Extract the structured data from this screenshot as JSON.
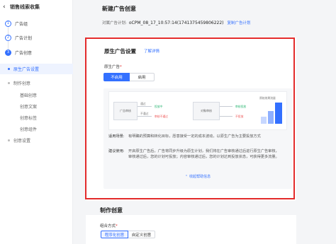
{
  "colors": {
    "accent": "#3370ff",
    "highlight": "#e32b2b",
    "sidebar_active_bg": "#eef3ff"
  },
  "sidebar": {
    "top_title": "销售线索收集",
    "steps": [
      {
        "num": "1",
        "label": "广告组",
        "state": "done"
      },
      {
        "num": "2",
        "label": "广告计划",
        "state": "done"
      },
      {
        "num": "3",
        "label": "广告创意",
        "state": "active"
      }
    ],
    "sub_items": [
      {
        "label": "原生广告设置",
        "active": true
      },
      {
        "label": "制作创意",
        "active": false
      },
      {
        "label": "基础创意",
        "active": false
      },
      {
        "label": "创意文案",
        "active": false
      },
      {
        "label": "创意标签",
        "active": false
      },
      {
        "label": "创意组件",
        "active": false
      },
      {
        "label": "创意设置",
        "active": false
      }
    ]
  },
  "main": {
    "title": "新建广告创意",
    "plan_label": "对属广告计划:",
    "plan_value": "oCPM_08_17_10:57:14(1741375459806222)",
    "plan_link": "复制广告计划",
    "native": {
      "title": "原生广告设置",
      "learn_more": "了解详情",
      "field_label": "原生广告",
      "required_mark": "*",
      "options": [
        "不启用",
        "启用"
      ],
      "selected": "不启用"
    },
    "diagram": {
      "box_ad": "广告审核",
      "branch_pass": "通过",
      "branch_fail": "不通过",
      "can_launch": "投放中",
      "reject": "审核不通过",
      "box_audit": "对象审核",
      "good": "审核投放",
      "bad": "不投放",
      "chart_label": "原始效果流量"
    },
    "scenario_key": "适用场景:",
    "scenario_text": "有明确的预算和转化目标，愿意接受一定的成本波动，以原生广告为主要投放方式",
    "advice_key": "建议使用:",
    "advice_text": "开启原生广告后，广告将同步升级为原生计划，我们将在广告审核通过后进行原生广告审核，审核通过后，您的计划可投放；内容审核通过后，您的计划达到投放状态，可获得更多流量。",
    "collapse_label": "收起帮助信息"
  },
  "make": {
    "title": "制作创意",
    "mode_label": "组合方式",
    "required_mark": "*",
    "options": [
      "程序化创意",
      "自定义创意"
    ],
    "selected": "程序化创意"
  }
}
